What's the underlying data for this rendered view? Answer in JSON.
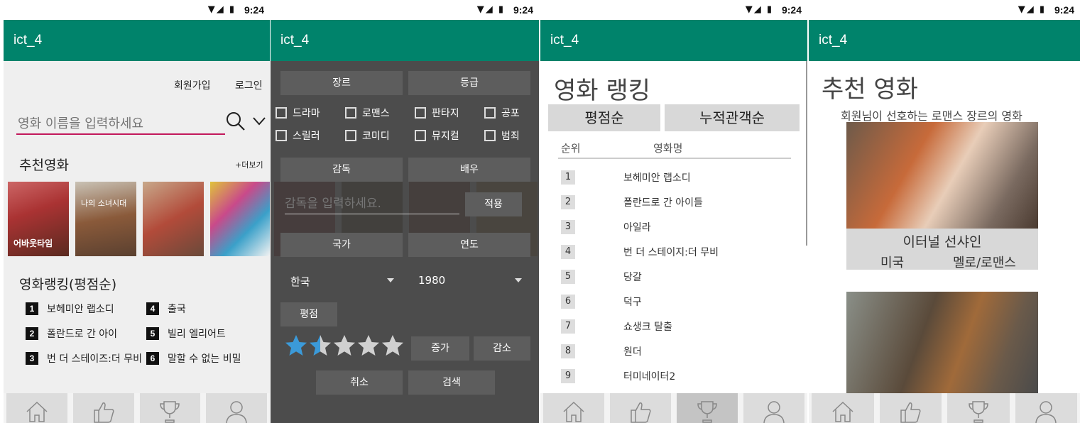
{
  "status": {
    "time": "9:24"
  },
  "app": {
    "title": "ict_4"
  },
  "screen1": {
    "signup": "회원가입",
    "login": "로그인",
    "search_placeholder": "영화 이름을 입력하세요",
    "recommend_title": "추천영화",
    "more": "+더보기",
    "ranking_title": "영화랭킹(평점순)",
    "rank_items": [
      {
        "n": "1",
        "title": "보헤미안 랩소디"
      },
      {
        "n": "2",
        "title": "폴란드로 간 아이"
      },
      {
        "n": "3",
        "title": "번 더 스테이즈:더 무비"
      },
      {
        "n": "4",
        "title": "출국"
      },
      {
        "n": "5",
        "title": "빌리 엘리어트"
      },
      {
        "n": "6",
        "title": "말할 수 없는 비밀"
      }
    ],
    "poster_titles": [
      "어바웃타임",
      "나의 소녀시대",
      "",
      ""
    ]
  },
  "screen2": {
    "genre_btn": "장르",
    "grade_btn": "등급",
    "genres": [
      "드라마",
      "로맨스",
      "판타지",
      "공포",
      "스릴러",
      "코미디",
      "뮤지컬",
      "범죄"
    ],
    "director_btn": "감독",
    "actor_btn": "배우",
    "director_placeholder": "감독을 입력하세요.",
    "apply_btn": "적용",
    "country_btn": "국가",
    "year_btn": "연도",
    "country_value": "한국",
    "year_value": "1980",
    "rating_btn": "평점",
    "rating_value": 1.5,
    "rating_max": 5,
    "increase_btn": "증가",
    "decrease_btn": "감소",
    "cancel_btn": "취소",
    "search_btn": "검색"
  },
  "screen3": {
    "title": "영화 랭킹",
    "tab_rating": "평점순",
    "tab_audience": "누적관객순",
    "col_rank": "순위",
    "col_title": "영화명",
    "rows": [
      {
        "n": "1",
        "title": "보헤미안 랩소디"
      },
      {
        "n": "2",
        "title": "폴란드로 간 아이들"
      },
      {
        "n": "3",
        "title": "아일라"
      },
      {
        "n": "4",
        "title": "번 더 스테이지:더 무비"
      },
      {
        "n": "5",
        "title": "당갈"
      },
      {
        "n": "6",
        "title": "덕구"
      },
      {
        "n": "7",
        "title": "쇼생크 탈출"
      },
      {
        "n": "8",
        "title": "원더"
      },
      {
        "n": "9",
        "title": "터미네이터2"
      }
    ]
  },
  "screen4": {
    "title": "추천 영화",
    "subtitle": "회원님이 선호하는 로맨스 장르의 영화",
    "movie1_title": "이터널 선샤인",
    "movie1_country": "미국",
    "movie1_genre": "멜로/로맨스"
  },
  "colors": {
    "appbar": "#00836b",
    "accent": "#c2185b",
    "star": "#3b9ad9"
  }
}
